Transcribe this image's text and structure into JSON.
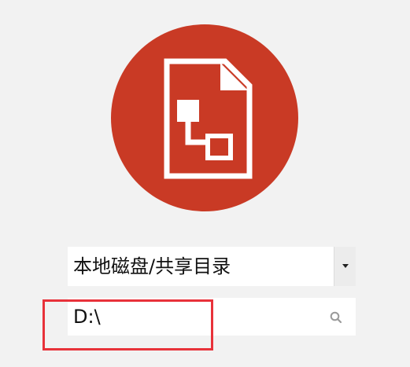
{
  "app_logo": {
    "icon": "file-diagram-icon",
    "background_color": "#c93a25",
    "foreground_color": "#ffffff"
  },
  "source_select": {
    "selected_label": "本地磁盘/共享目录"
  },
  "path_field": {
    "value": "D:\\"
  },
  "search": {
    "icon": "search-icon"
  },
  "highlight": {
    "color": "#e8323a"
  }
}
